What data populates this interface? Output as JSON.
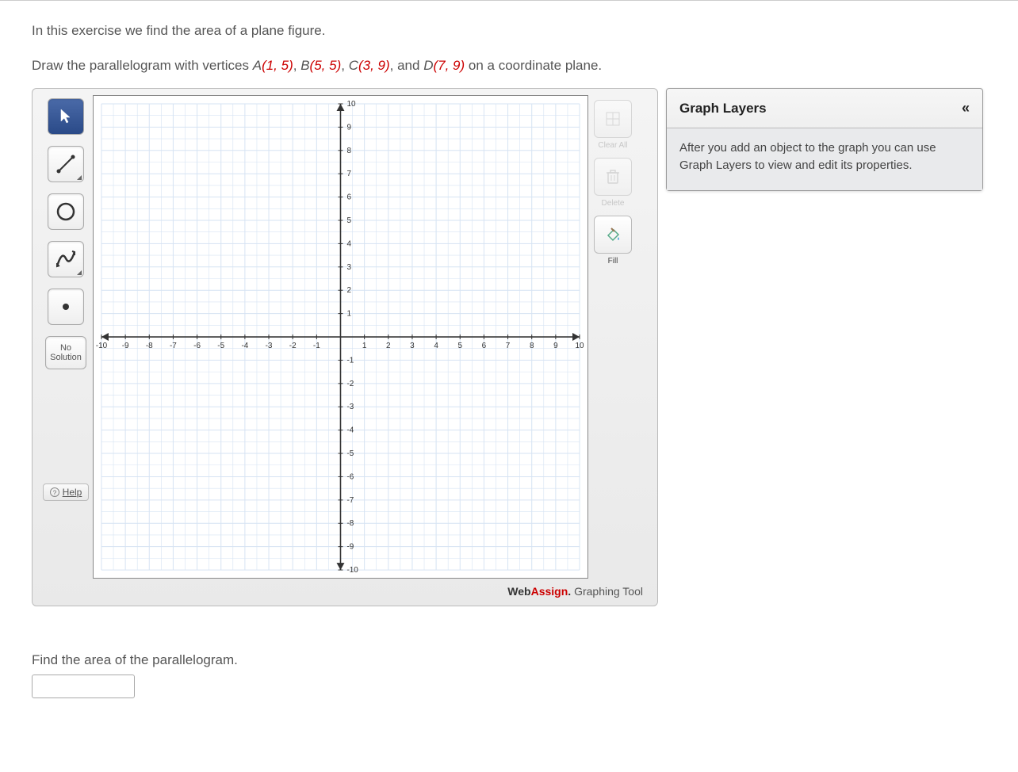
{
  "intro": "In this exercise we find the area of a plane figure.",
  "prompt_prefix": "Draw the parallelogram with vertices  ",
  "points": [
    {
      "label": "A",
      "coords": "(1, 5)"
    },
    {
      "label": "B",
      "coords": "(5, 5)"
    },
    {
      "label": "C",
      "coords": "(3, 9)"
    },
    {
      "label": "D",
      "coords": "(7, 9)"
    }
  ],
  "prompt_suffix": "  on a coordinate plane.",
  "toolbar": {
    "select": "Select",
    "line": "Line",
    "circle": "Circle",
    "curve": "Curve",
    "point": "Point",
    "no_solution_line1": "No",
    "no_solution_line2": "Solution",
    "help": "Help"
  },
  "right_tools": {
    "clear_all": "Clear All",
    "delete": "Delete",
    "fill": "Fill"
  },
  "layers": {
    "title": "Graph Layers",
    "hint": "After you add an object to the graph you can use Graph Layers to view and edit its properties."
  },
  "brand": {
    "web": "Web",
    "assign": "Assign",
    "dot": ".",
    "suffix": " Graphing Tool"
  },
  "question_area": "Find the area of the parallelogram.",
  "answer_value": "",
  "chart_data": {
    "type": "scatter",
    "title": "",
    "xlabel": "",
    "ylabel": "",
    "xlim": [
      -10,
      10
    ],
    "ylim": [
      -10,
      10
    ],
    "x_ticks": [
      -10,
      -9,
      -8,
      -7,
      -6,
      -5,
      -4,
      -3,
      -2,
      -1,
      1,
      2,
      3,
      4,
      5,
      6,
      7,
      8,
      9,
      10
    ],
    "y_ticks": [
      -10,
      -9,
      -8,
      -7,
      -6,
      -5,
      -4,
      -3,
      -2,
      -1,
      1,
      2,
      3,
      4,
      5,
      6,
      7,
      8,
      9,
      10
    ],
    "grid": true,
    "series": []
  }
}
